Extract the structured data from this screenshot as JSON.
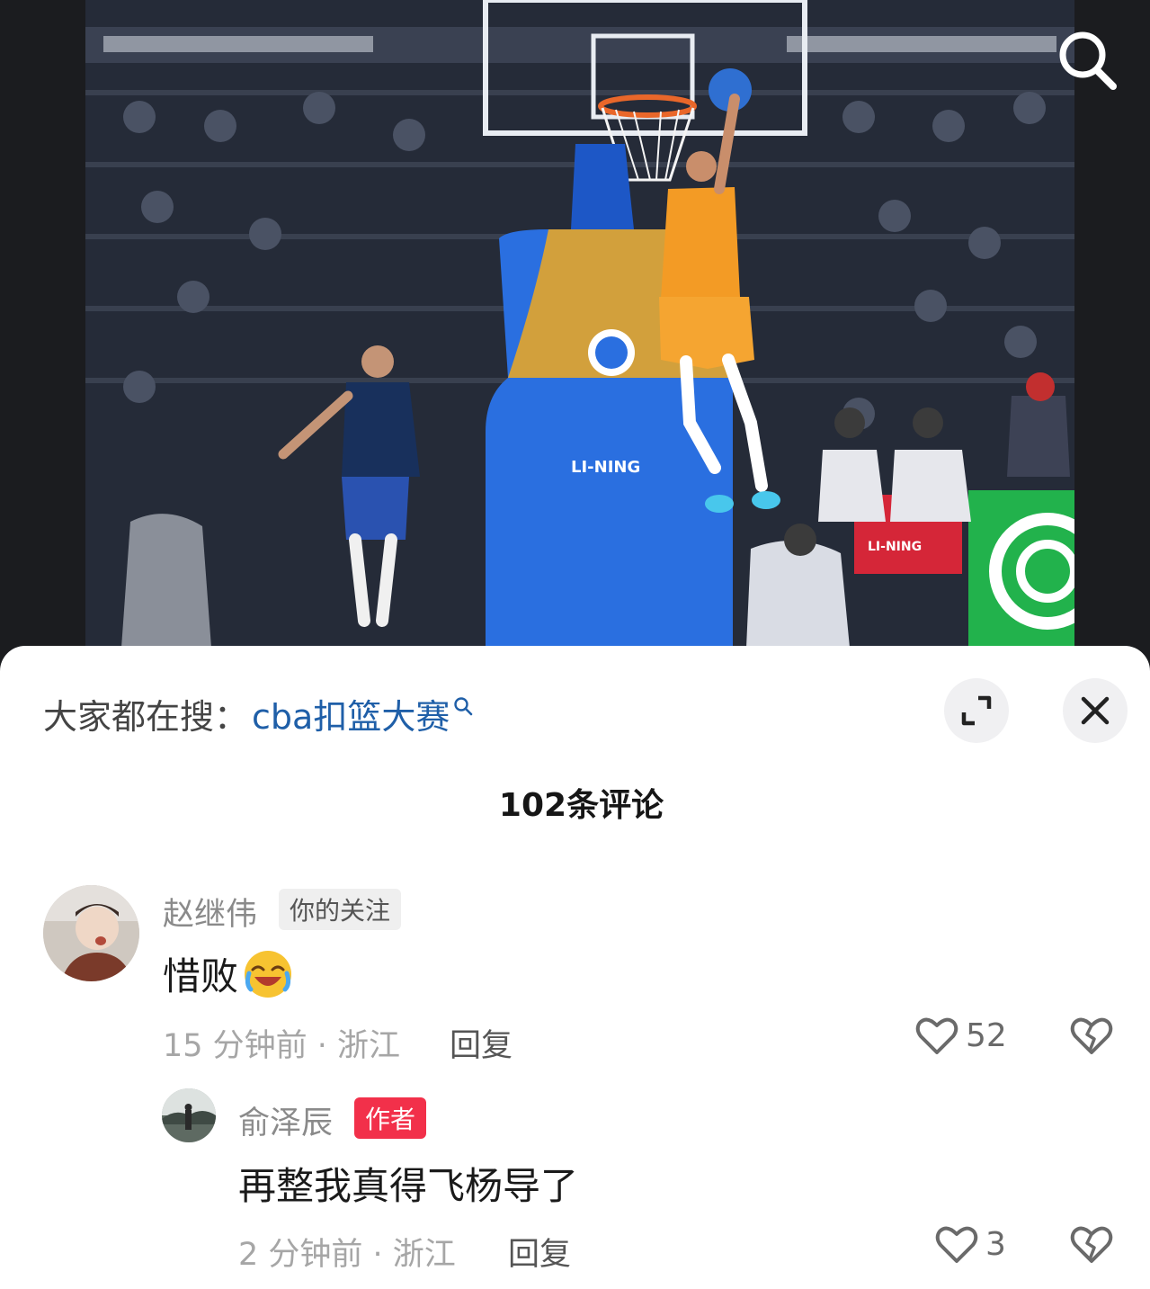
{
  "header": {
    "search_icon": "search-icon"
  },
  "sheet": {
    "trending_prefix": "大家都在搜：",
    "trending_term": "cba扣篮大赛",
    "expand_icon": "expand-icon",
    "close_icon": "close-icon",
    "comment_count": "102条评论"
  },
  "comments": [
    {
      "user": "赵继伟",
      "tag": "你的关注",
      "text": "惜败",
      "emoji": "😭",
      "meta": "15 分钟前 · 浙江",
      "reply_label": "回复",
      "likes": "52"
    }
  ],
  "replies": [
    {
      "user": "俞泽辰",
      "tag": "作者",
      "text": "再整我真得飞杨导了",
      "meta": "2 分钟前 · 浙江",
      "reply_label": "回复",
      "likes": "3"
    }
  ],
  "colors": {
    "accent_link": "#1f5fa8",
    "author_tag": "#f2304a"
  }
}
